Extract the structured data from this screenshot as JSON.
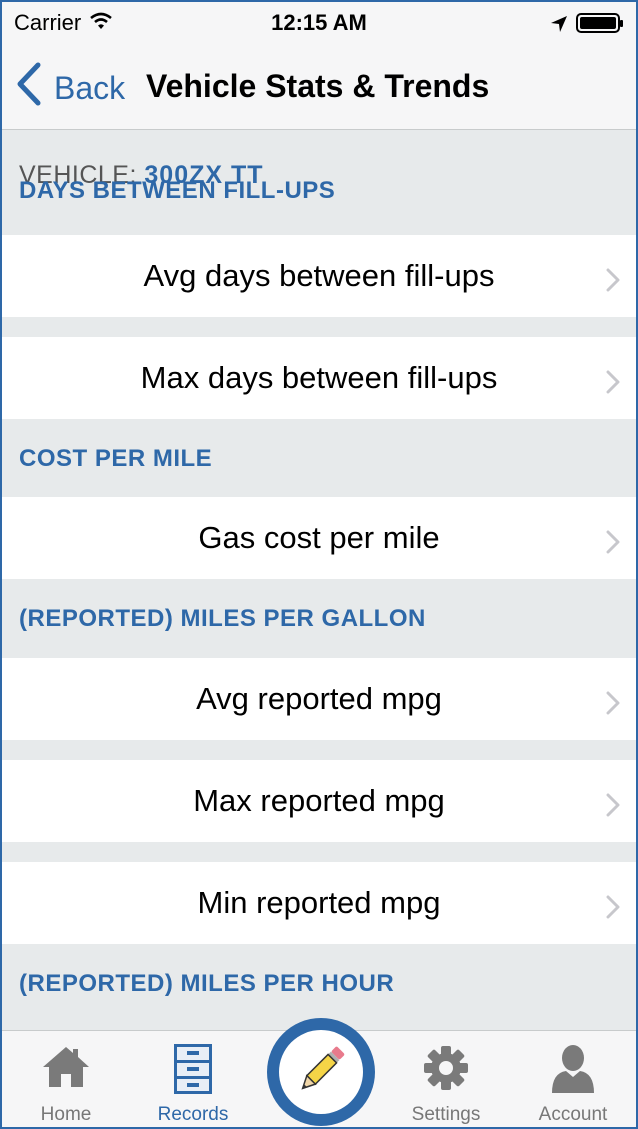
{
  "status_bar": {
    "carrier": "Carrier",
    "time": "12:15 AM"
  },
  "nav": {
    "back_label": "Back",
    "title": "Vehicle Stats & Trends"
  },
  "vehicle": {
    "label": "VEHICLE:",
    "name": "300ZX TT"
  },
  "sections": [
    {
      "header": "DAYS BETWEEN FILL-UPS",
      "rows": [
        "Avg days between fill-ups",
        "Max days between fill-ups"
      ]
    },
    {
      "header": "COST PER MILE",
      "rows": [
        "Gas cost per mile"
      ]
    },
    {
      "header": "(REPORTED) MILES PER GALLON",
      "rows": [
        "Avg reported mpg",
        "Max reported mpg",
        "Min reported mpg"
      ]
    },
    {
      "header": "(REPORTED) MILES PER HOUR",
      "rows": []
    }
  ],
  "tabs": [
    {
      "label": "Home",
      "icon": "home-icon"
    },
    {
      "label": "Records",
      "icon": "file-cabinet-icon",
      "active": true
    },
    {
      "label": "",
      "icon": "pencil-icon"
    },
    {
      "label": "Settings",
      "icon": "gear-icon"
    },
    {
      "label": "Account",
      "icon": "person-icon"
    }
  ],
  "colors": {
    "accent": "#2e68a8",
    "background": "#e7eaeb",
    "bar": "#f6f6f7"
  }
}
